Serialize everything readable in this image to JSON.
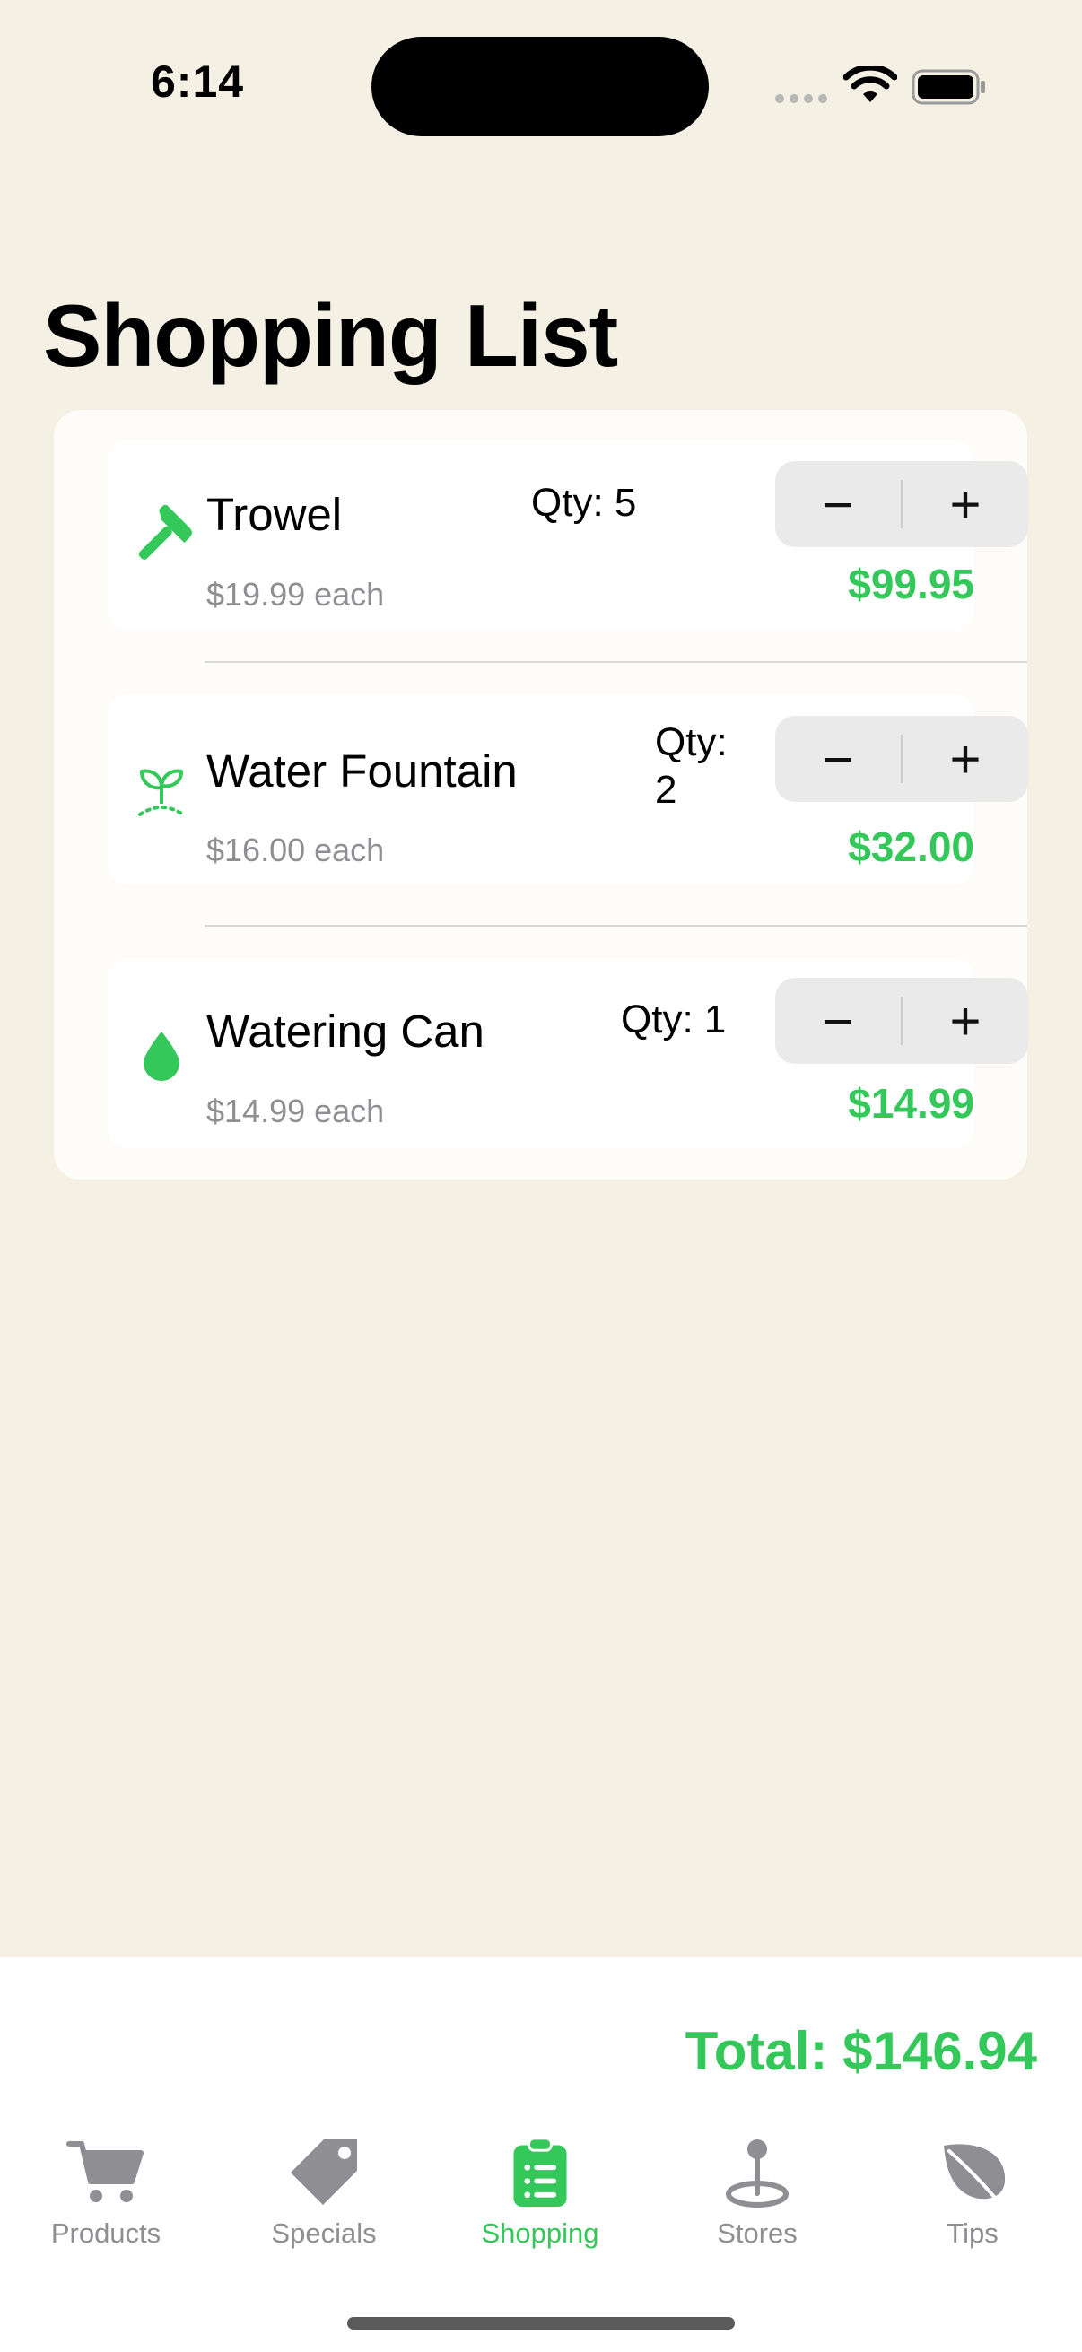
{
  "status_bar": {
    "time": "6:14"
  },
  "page": {
    "title": "Shopping List"
  },
  "items": [
    {
      "name": "Trowel",
      "unit_price": "$19.99 each",
      "quantity_label": "Qty: 5",
      "line_total": "$99.95",
      "icon": "hammer-icon",
      "decrement": "−",
      "increment": "+"
    },
    {
      "name": "Water Fountain",
      "unit_price": "$16.00 each",
      "quantity_label_line1": "Qty:",
      "quantity_label_line2": "2",
      "line_total": "$32.00",
      "icon": "sprout-icon",
      "decrement": "−",
      "increment": "+"
    },
    {
      "name": "Watering Can",
      "unit_price": "$14.99 each",
      "quantity_label": "Qty: 1",
      "line_total": "$14.99",
      "icon": "drop-icon",
      "decrement": "−",
      "increment": "+"
    }
  ],
  "summary": {
    "total_label": "Total: $146.94"
  },
  "tabs": [
    {
      "label": "Products",
      "icon": "cart-icon",
      "active": false
    },
    {
      "label": "Specials",
      "icon": "tag-icon",
      "active": false
    },
    {
      "label": "Shopping",
      "icon": "clipboard-list-icon",
      "active": true
    },
    {
      "label": "Stores",
      "icon": "map-pin-icon",
      "active": false
    },
    {
      "label": "Tips",
      "icon": "leaf-icon",
      "active": false
    }
  ],
  "colors": {
    "accent": "#34C759",
    "background": "#F4F0E4",
    "inactive": "#8E8E93"
  }
}
